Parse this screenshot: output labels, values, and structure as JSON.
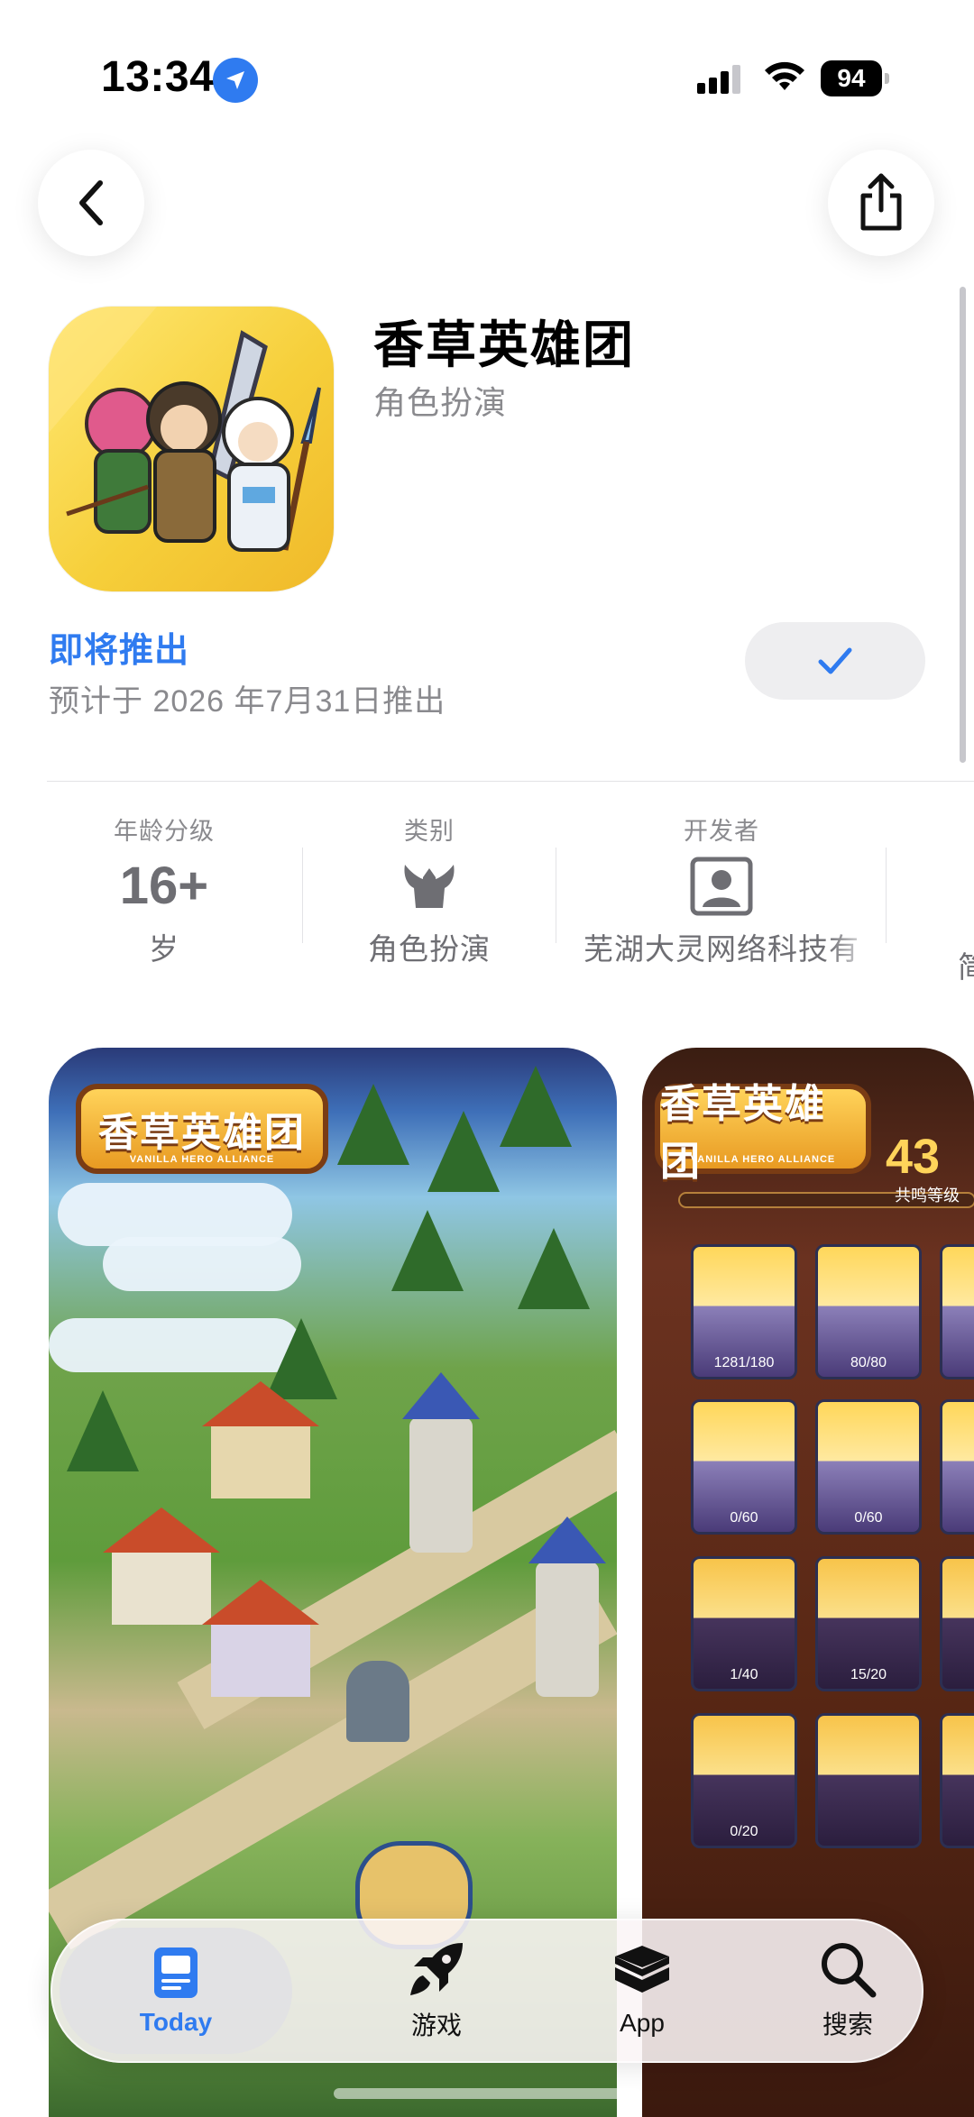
{
  "status_bar": {
    "time": "13:34",
    "battery": "94"
  },
  "app": {
    "title": "香草英雄团",
    "subtitle": "角色扮演",
    "availability": "即将推出",
    "release_note": "预计于 2026 年7月31日推出"
  },
  "info": {
    "age": {
      "label": "年龄分级",
      "value": "16+",
      "sub": "岁"
    },
    "category": {
      "label": "类别",
      "sub": "角色扮演",
      "icon": "viking-helmet-icon"
    },
    "developer": {
      "label": "开发者",
      "sub": "芜湖大灵网络科技有",
      "icon": "person-badge-icon"
    },
    "next_partial": "简"
  },
  "screenshots": {
    "logo_text": "香草英雄团",
    "logo_sub": "VANILLA HERO ALLIANCE",
    "level_value": "43",
    "level_label": "共鸣等级",
    "card_counts": [
      "1281/180",
      "80/80",
      "0/60",
      "0/60",
      "1/40",
      "15/20",
      "0/20"
    ]
  },
  "tab_bar": {
    "tabs": [
      {
        "label": "Today",
        "icon": "today-icon",
        "active": true
      },
      {
        "label": "游戏",
        "icon": "rocket-icon"
      },
      {
        "label": "App",
        "icon": "layers-icon"
      },
      {
        "label": "搜索",
        "icon": "search-icon"
      }
    ]
  },
  "colors": {
    "accent": "#2f7bf0",
    "secondary_text": "#8a8a8e"
  }
}
